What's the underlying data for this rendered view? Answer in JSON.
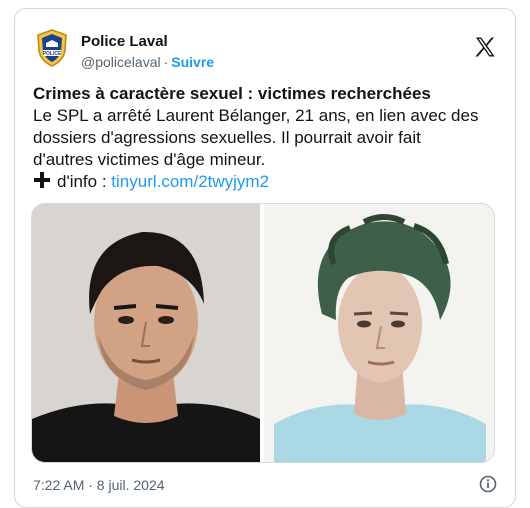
{
  "account": {
    "display_name": "Police Laval",
    "handle": "@policelaval",
    "separator": "·",
    "follow_label": "Suivre",
    "badge_text": "POLICE",
    "avatar_icon": "police-badge-icon"
  },
  "post": {
    "headline": "Crimes à caractère sexuel : victimes recherchées",
    "body_lines": [
      "Le SPL a arrêté Laurent Bélanger, 21 ans, en lien avec des",
      "dossiers d'agressions sexuelles. Il pourrait avoir fait",
      "d'autres victimes d'âge mineur."
    ],
    "info_label": "d'info : ",
    "link_text": "tinyurl.com/2twyjym2"
  },
  "footer": {
    "timestamp": "7:22 AM · 8 juil. 2024"
  },
  "colors": {
    "link": "#1d9bf0",
    "text": "#0f1419",
    "muted": "#536471",
    "border": "#cfd9de",
    "right_photo_shirt": "#a9d8e4",
    "right_photo_hair": "#3f6048"
  },
  "icons": {
    "brand": "x-logo-icon",
    "plus": "plus-icon",
    "info": "info-icon"
  }
}
